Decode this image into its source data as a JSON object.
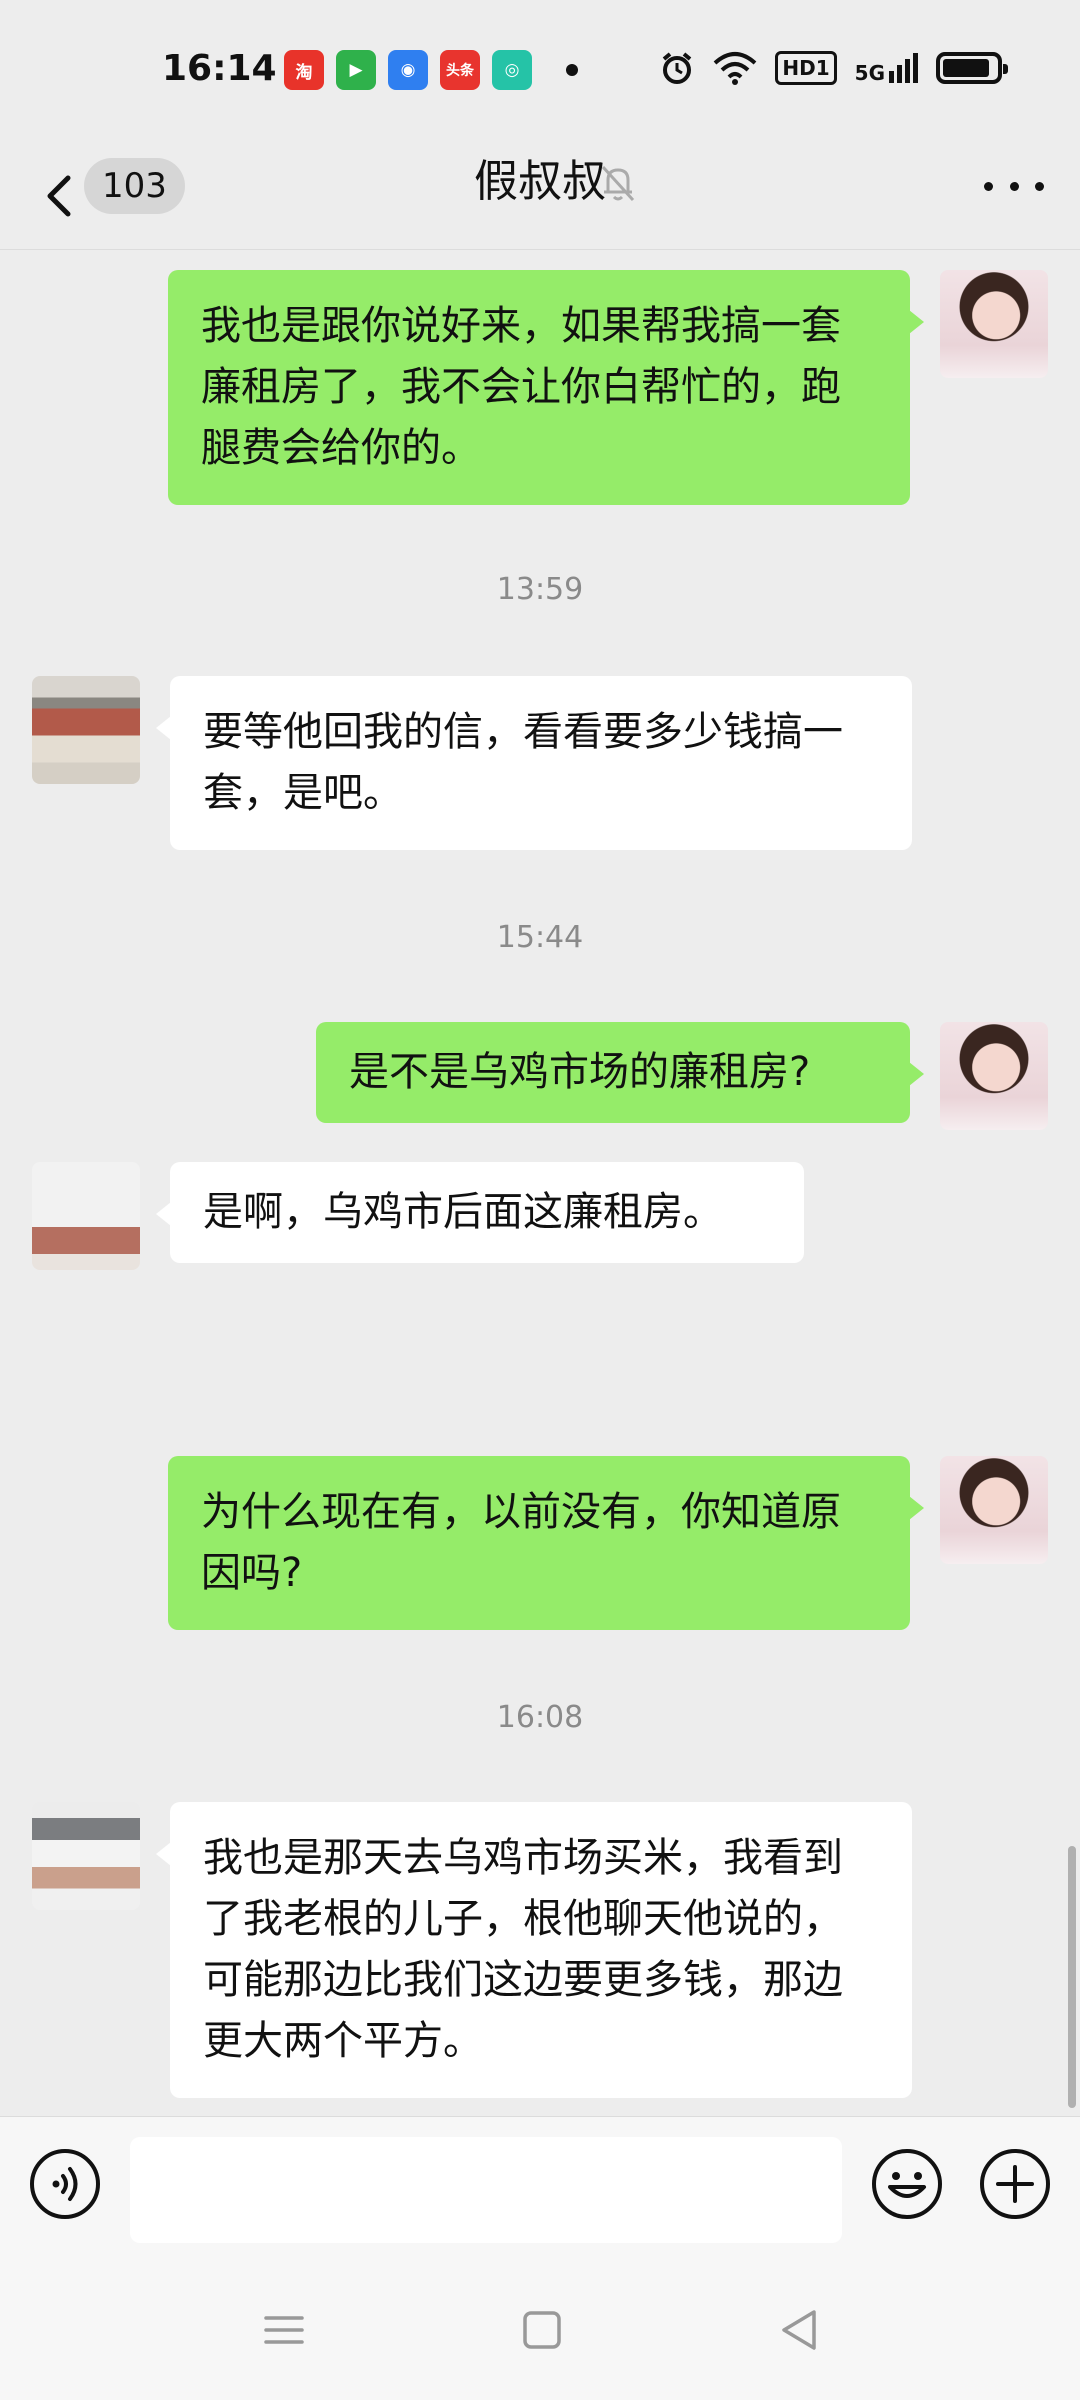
{
  "status_bar": {
    "time": "16:14",
    "app_icons": [
      {
        "name": "taobao-icon",
        "label": "淘",
        "color": "#e8332a"
      },
      {
        "name": "video-app-icon",
        "label": "▶",
        "color": "#2fb14b"
      },
      {
        "name": "browser-app-icon",
        "label": "◉",
        "color": "#2f7ff0"
      },
      {
        "name": "toutiao-icon",
        "label": "头条",
        "color": "#e8342e"
      },
      {
        "name": "message-app-icon",
        "label": "◎",
        "color": "#25c3a7"
      }
    ],
    "hd_label": "HD1",
    "network_label": "5G"
  },
  "header": {
    "unread_count": "103",
    "title": "假叔叔"
  },
  "messages": [
    {
      "side": "out",
      "text": "我也是跟你说好来，如果帮我搞一套廉租房了，我不会让你白帮忙的，跑腿费会给你的。"
    },
    {
      "type": "time",
      "text": "13:59"
    },
    {
      "side": "in",
      "text": "要等他回我的信，看看要多少钱搞一套，是吧。"
    },
    {
      "type": "time",
      "text": "15:44"
    },
    {
      "side": "out",
      "text": "是不是乌鸡市场的廉租房?"
    },
    {
      "side": "in",
      "text": "是啊，乌鸡市后面这廉租房。"
    },
    {
      "side": "out",
      "text": "为什么现在有，以前没有，你知道原因吗?"
    },
    {
      "type": "time",
      "text": "16:08"
    },
    {
      "side": "in",
      "text": "我也是那天去乌鸡市场买米，我看到了我老根的儿子，根他聊天他说的，可能那边比我们这边要更多钱，那边更大两个平方。"
    }
  ],
  "input": {
    "value": "",
    "placeholder": ""
  },
  "colors": {
    "outgoing_bubble": "#95ec69",
    "incoming_bubble": "#ffffff",
    "background": "#ededed"
  }
}
